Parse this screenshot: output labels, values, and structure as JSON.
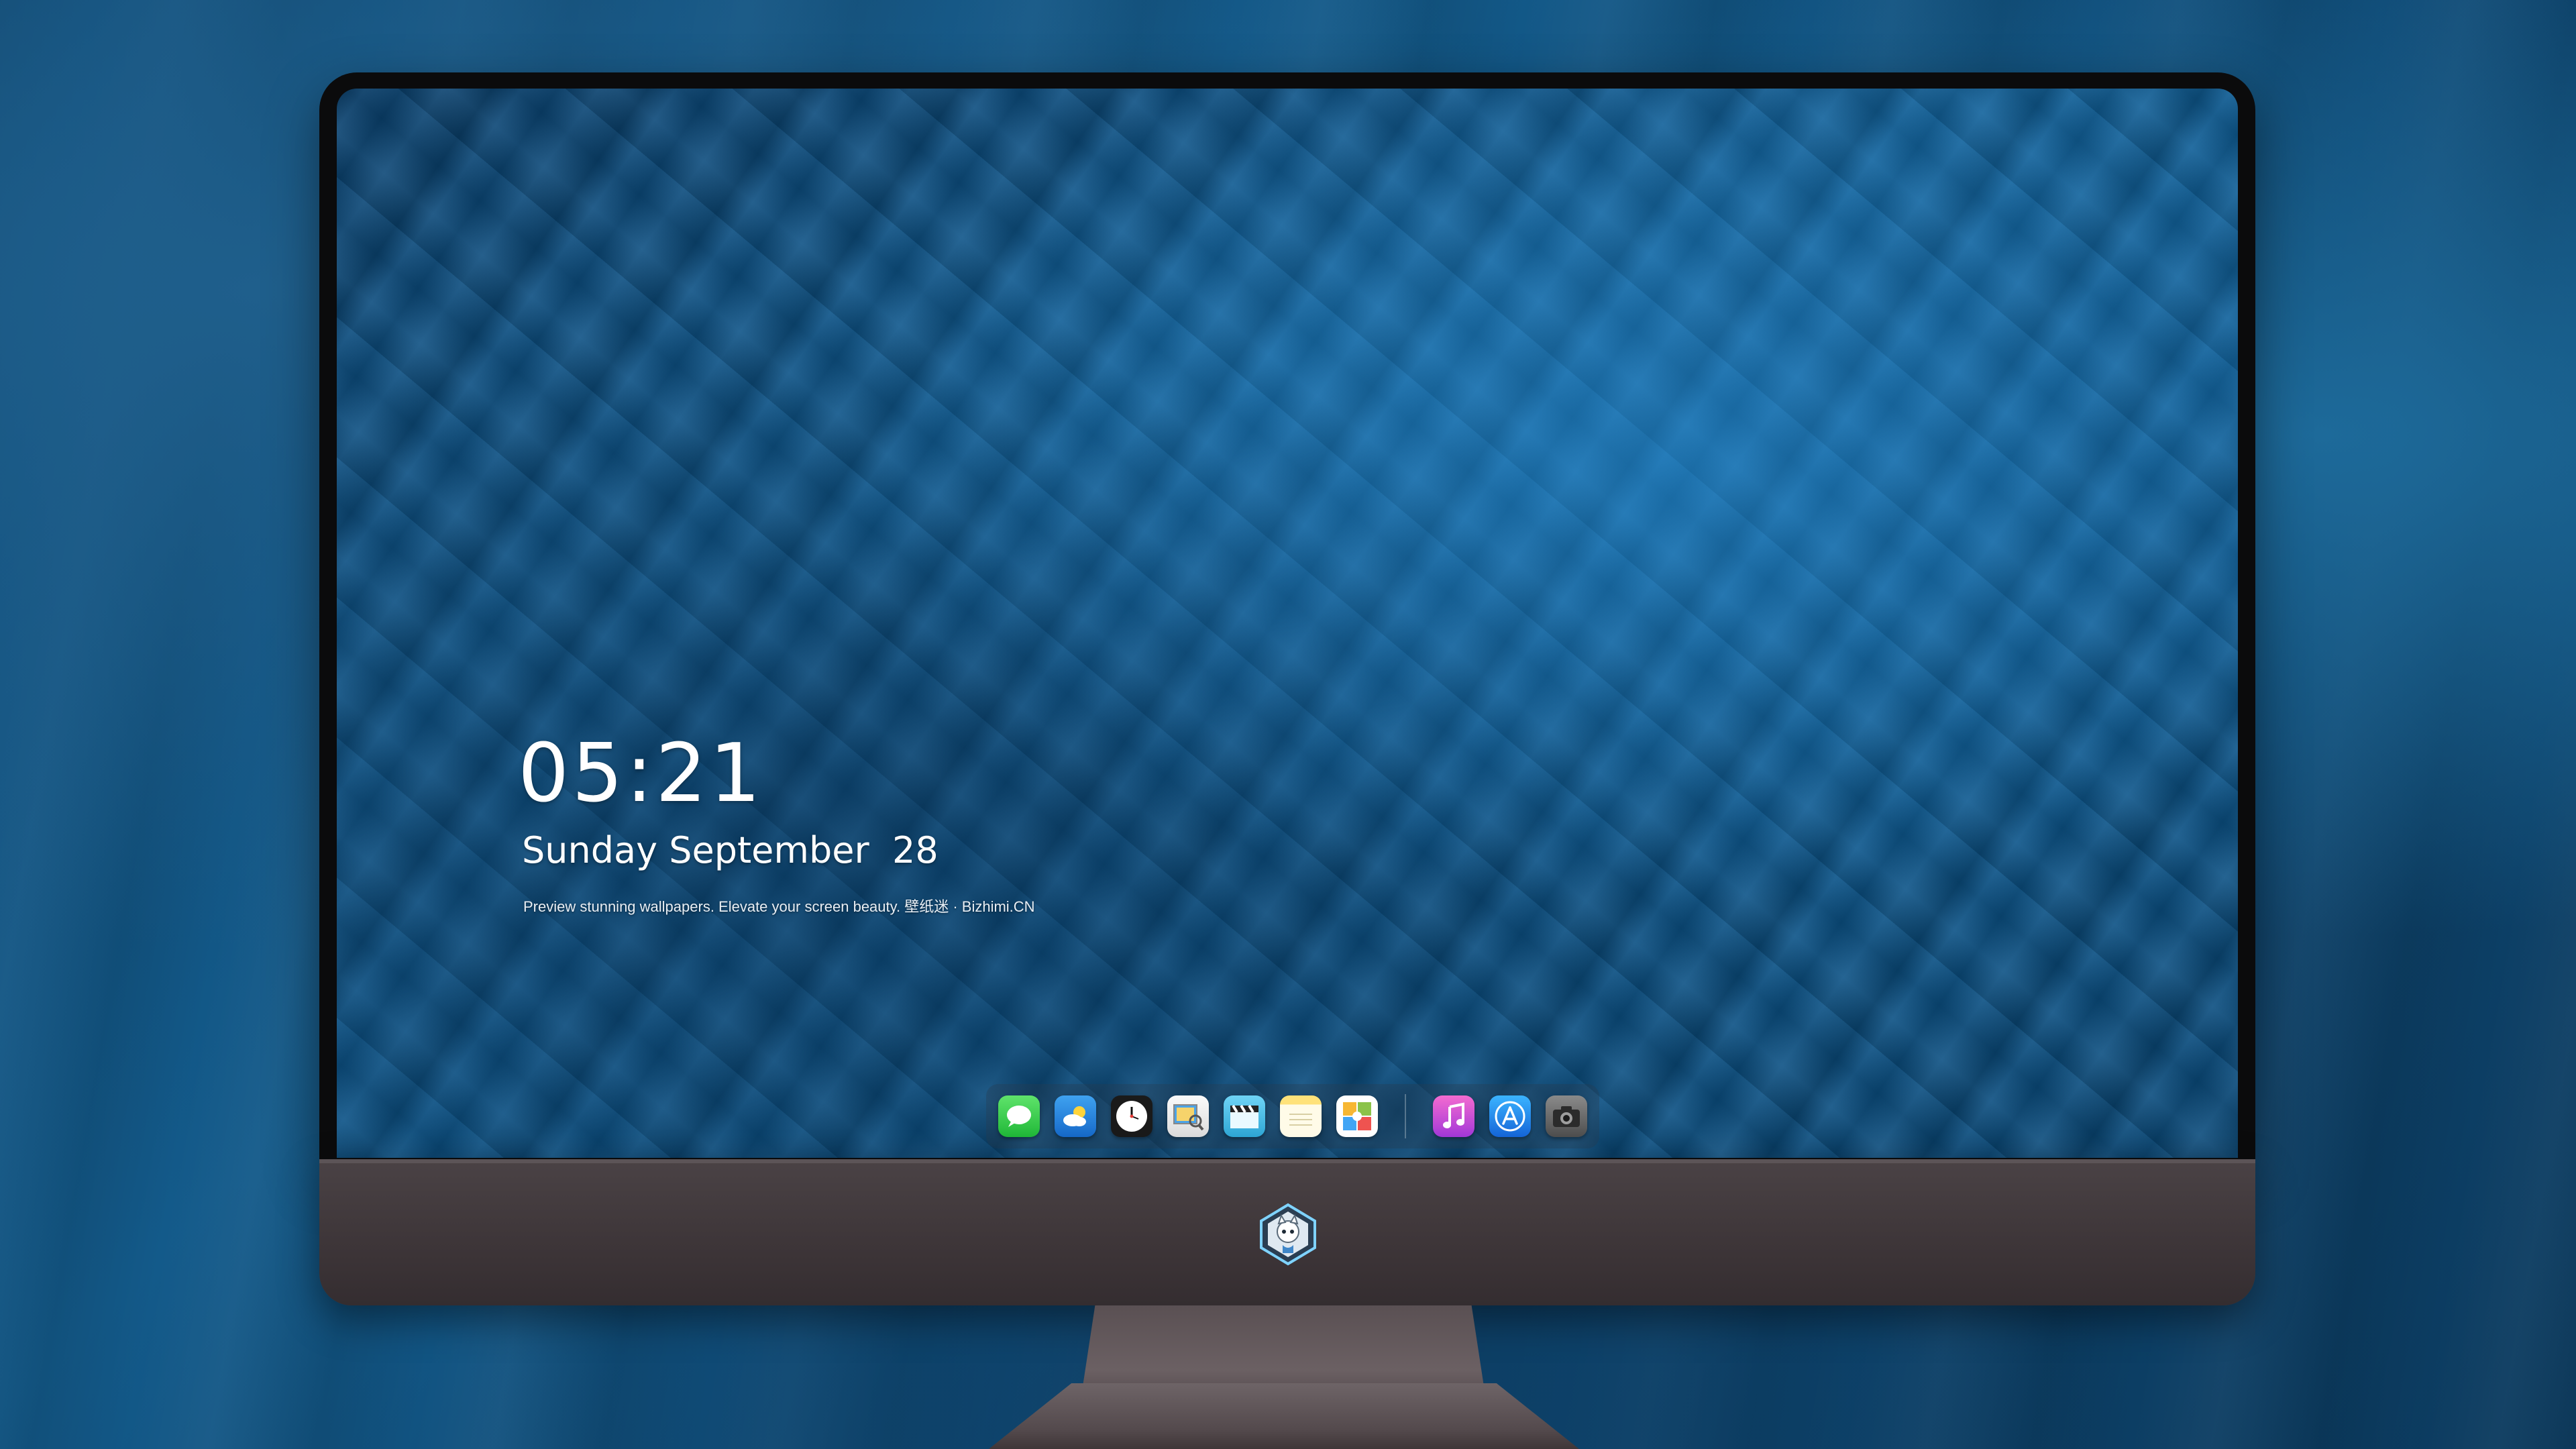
{
  "lock_screen": {
    "time": "05:21",
    "date": "Sunday September  28",
    "tagline": "Preview stunning wallpapers. Elevate your screen beauty. 壁纸迷 · Bizhimi.CN"
  },
  "dock": {
    "apps": [
      {
        "name": "messages-icon",
        "color": "#2ecc40"
      },
      {
        "name": "weather-icon",
        "color": "#1e88e5"
      },
      {
        "name": "clock-icon",
        "color": "#1a1a1a"
      },
      {
        "name": "preview-icon",
        "color": "#f4f4f4"
      },
      {
        "name": "clapperboard-icon",
        "color": "#38b6e8"
      },
      {
        "name": "notes-icon",
        "color": "#ffd54a"
      },
      {
        "name": "photos-icon",
        "color": "#ffffff"
      },
      {
        "name": "music-icon",
        "color": "#e040a0"
      },
      {
        "name": "app-store-icon",
        "color": "#1e90ff"
      },
      {
        "name": "camera-icon",
        "color": "#6b6b6b"
      }
    ]
  },
  "colors": {
    "wallpaper": "#0c5a92",
    "bezel": "#0b0b0c",
    "chin": "#3d3538"
  }
}
